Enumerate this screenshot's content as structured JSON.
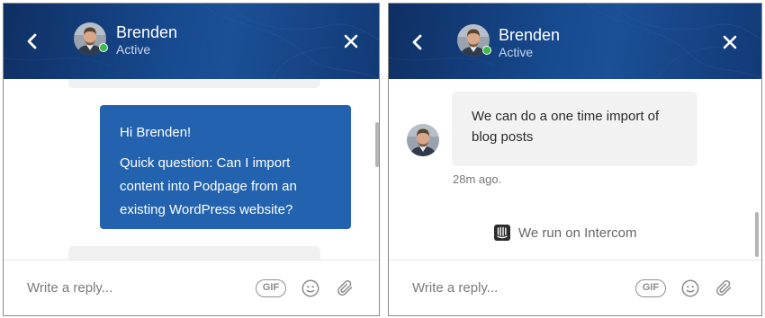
{
  "colors": {
    "header_dark": "#0f2f63",
    "header_light": "#1c4f96",
    "user_bubble": "#2262ae",
    "admin_bubble": "#f2f2f2",
    "presence_online": "#3cb94a"
  },
  "left_panel": {
    "header": {
      "back_icon": "chevron-left-icon",
      "name": "Brenden",
      "status": "Active",
      "close_icon": "close-icon"
    },
    "messages": [
      {
        "from": "user",
        "lines": [
          "Hi Brenden!",
          "Quick question: Can I import content into Podpage from an existing WordPress website?"
        ]
      }
    ],
    "composer": {
      "placeholder": "Write a reply...",
      "gif_label": "GIF",
      "emoji_icon": "emoji-icon",
      "attach_icon": "paperclip-icon"
    }
  },
  "right_panel": {
    "header": {
      "back_icon": "chevron-left-icon",
      "name": "Brenden",
      "status": "Active",
      "close_icon": "close-icon"
    },
    "messages": [
      {
        "from": "admin",
        "text": "We can do a one time import of blog posts",
        "time": "28m ago."
      }
    ],
    "powered_by": {
      "icon": "intercom-logo-icon",
      "text": "We run on Intercom"
    },
    "composer": {
      "placeholder": "Write a reply...",
      "gif_label": "GIF",
      "emoji_icon": "emoji-icon",
      "attach_icon": "paperclip-icon"
    }
  }
}
